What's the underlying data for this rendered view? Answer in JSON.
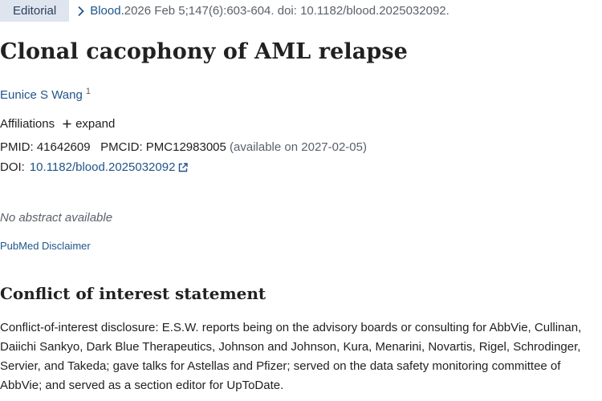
{
  "header": {
    "article_type": "Editorial",
    "journal": "Blood.",
    "citation": " 2026 Feb 5;147(6):603-604. doi: 10.1182/blood.2025032092."
  },
  "article": {
    "title": "Clonal cacophony of AML relapse",
    "author_name": "Eunice S Wang",
    "author_affiliation_ref": "1",
    "affiliations_label": "Affiliations",
    "expand_label": "expand",
    "pmid_label": "PMID:",
    "pmid": "41642609",
    "pmcid_label": "PMCID:",
    "pmcid": "PMC12983005",
    "pmcid_note": "(available on 2027-02-05)",
    "doi_label": "DOI:",
    "doi": "10.1182/blood.2025032092",
    "no_abstract": "No abstract available",
    "disclaimer": "PubMed Disclaimer"
  },
  "coi": {
    "heading": "Conflict of interest statement",
    "text": "Conflict-of-interest disclosure: E.S.W. reports being on the advisory boards or consulting for AbbVie, Cullinan, Daiichi Sankyo, Dark Blue Therapeutics, Johnson and Johnson, Kura, Menarini, Novartis, Rigel, Schrodinger, Servier, and Takeda; gave talks for Astellas and Pfizer; served on the data safety monitoring committee of AbbVie; and served as a section editor for UpToDate."
  },
  "colors": {
    "link": "#20558a",
    "badge_bg": "#dfe5ef",
    "muted_text": "#5b616b",
    "body_text": "#212121"
  },
  "icons": {
    "breadcrumb": "chevron-right-icon",
    "expand": "plus-icon",
    "external": "external-link-icon"
  }
}
